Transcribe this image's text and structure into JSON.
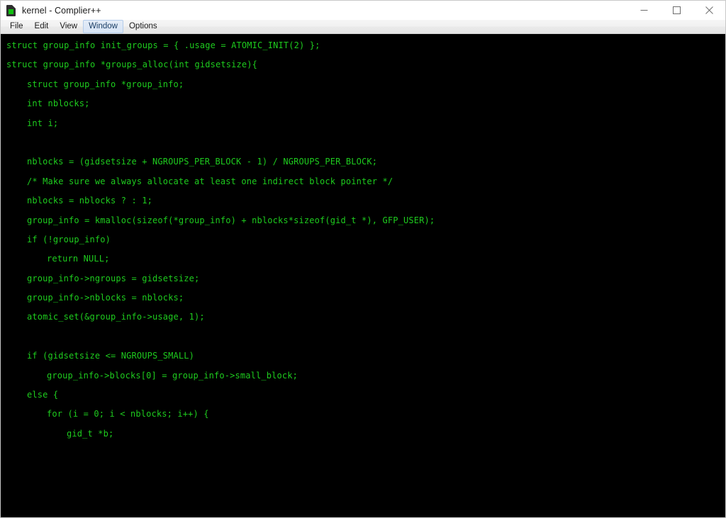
{
  "window": {
    "title": "kernel - Complier++",
    "icon": "file-code-icon",
    "controls": {
      "minimize": "minimize-button",
      "maximize": "maximize-button",
      "close": "close-button"
    }
  },
  "menubar": {
    "items": [
      {
        "label": "File",
        "active": false
      },
      {
        "label": "Edit",
        "active": false
      },
      {
        "label": "View",
        "active": false
      },
      {
        "label": "Window",
        "active": true
      },
      {
        "label": "Options",
        "active": false
      }
    ]
  },
  "editor": {
    "background_color": "#000000",
    "text_color": "#1ecc1e",
    "lines": [
      {
        "indent": 0,
        "text": "struct group_info init_groups = { .usage = ATOMIC_INIT(2) };"
      },
      {
        "indent": 0,
        "text": "struct group_info *groups_alloc(int gidsetsize){"
      },
      {
        "indent": 1,
        "text": "struct group_info *group_info;"
      },
      {
        "indent": 1,
        "text": "int nblocks;"
      },
      {
        "indent": 1,
        "text": "int i;"
      },
      {
        "indent": 0,
        "text": ""
      },
      {
        "indent": 1,
        "text": "nblocks = (gidsetsize + NGROUPS_PER_BLOCK - 1) / NGROUPS_PER_BLOCK;"
      },
      {
        "indent": 1,
        "text": "/* Make sure we always allocate at least one indirect block pointer */"
      },
      {
        "indent": 1,
        "text": "nblocks = nblocks ? : 1;"
      },
      {
        "indent": 1,
        "text": "group_info = kmalloc(sizeof(*group_info) + nblocks*sizeof(gid_t *), GFP_USER);"
      },
      {
        "indent": 1,
        "text": "if (!group_info)"
      },
      {
        "indent": 2,
        "text": "return NULL;"
      },
      {
        "indent": 1,
        "text": "group_info->ngroups = gidsetsize;"
      },
      {
        "indent": 1,
        "text": "group_info->nblocks = nblocks;"
      },
      {
        "indent": 1,
        "text": "atomic_set(&group_info->usage, 1);"
      },
      {
        "indent": 0,
        "text": ""
      },
      {
        "indent": 1,
        "text": "if (gidsetsize <= NGROUPS_SMALL)"
      },
      {
        "indent": 2,
        "text": "group_info->blocks[0] = group_info->small_block;"
      },
      {
        "indent": 1,
        "text": "else {"
      },
      {
        "indent": 2,
        "text": "for (i = 0; i < nblocks; i++) {"
      },
      {
        "indent": 3,
        "text": "gid_t *b;"
      }
    ]
  }
}
